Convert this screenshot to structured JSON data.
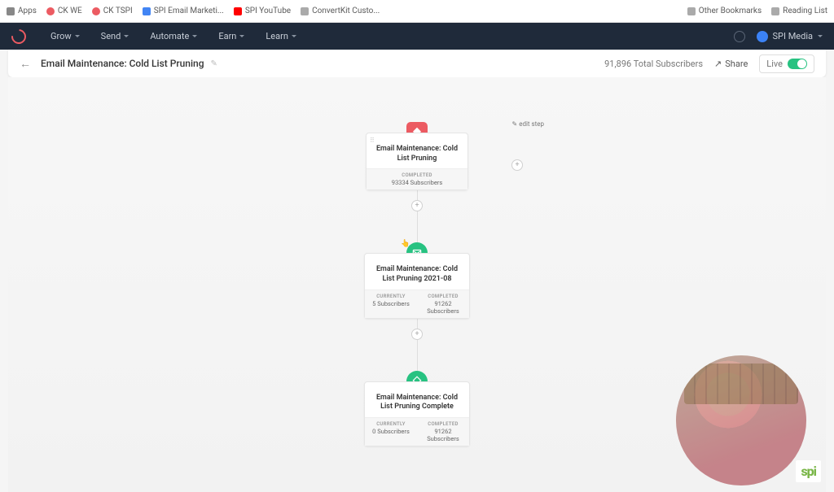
{
  "bookmarks": {
    "left": [
      {
        "label": "Apps",
        "ico": "grid"
      },
      {
        "label": "CK WE",
        "ico": "red"
      },
      {
        "label": "CK TSPI",
        "ico": "red"
      },
      {
        "label": "SPI Email Marketi...",
        "ico": "blue"
      },
      {
        "label": "SPI YouTube",
        "ico": "yt"
      },
      {
        "label": "ConvertKit Custo...",
        "ico": "doc"
      }
    ],
    "right": [
      {
        "label": "Other Bookmarks",
        "ico": "doc"
      },
      {
        "label": "Reading List",
        "ico": "doc"
      }
    ]
  },
  "nav": {
    "items": [
      "Grow",
      "Send",
      "Automate",
      "Earn",
      "Learn"
    ],
    "user": "SPI Media"
  },
  "subnav": {
    "title": "Email Maintenance: Cold List Pruning",
    "total_subs": "91,896 Total Subscribers",
    "share": "Share",
    "live": "Live"
  },
  "flow": {
    "edit_step": "edit step",
    "nodes": [
      {
        "title": "Email Maintenance: Cold List Pruning",
        "single_stat": {
          "label": "COMPLETED",
          "value": "93334 Subscribers"
        },
        "color": "red"
      },
      {
        "title": "Email Maintenance: Cold List Pruning 2021-08",
        "stats": [
          {
            "label": "CURRENTLY",
            "value": "5 Subscribers"
          },
          {
            "label": "COMPLETED",
            "value": "91262 Subscribers"
          }
        ],
        "color": "green"
      },
      {
        "title": "Email Maintenance: Cold List Pruning Complete",
        "stats": [
          {
            "label": "CURRENTLY",
            "value": "0 Subscribers"
          },
          {
            "label": "COMPLETED",
            "value": "91262 Subscribers"
          }
        ],
        "color": "green"
      }
    ]
  },
  "brand": "spi"
}
